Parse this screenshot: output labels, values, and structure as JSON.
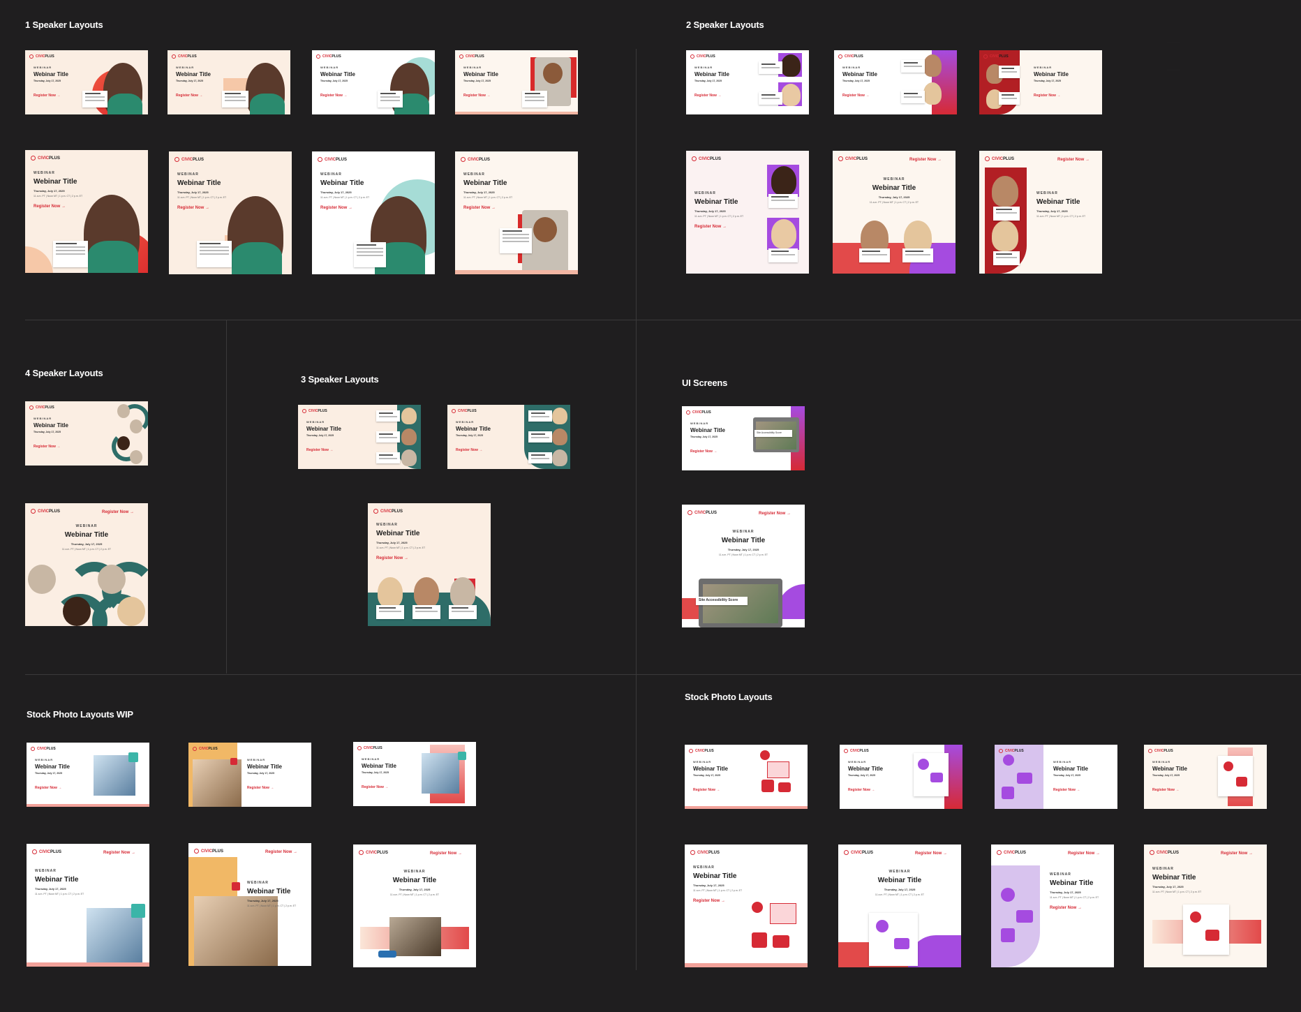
{
  "sections": {
    "one_speaker": "1 Speaker Layouts",
    "two_speaker": "2 Speaker Layouts",
    "four_speaker": "4 Speaker Layouts",
    "three_speaker": "3 Speaker Layouts",
    "ui_screens": "UI Screens",
    "stock_wip": "Stock Photo Layouts WIP",
    "stock": "Stock Photo Layouts"
  },
  "card": {
    "brand_prefix": "CIVIC",
    "brand_suffix": "PLUS",
    "eyebrow": "WEBINAR",
    "title": "Webinar Title",
    "date": "Thursday, July 17, 2025",
    "times": "11 a.m. PT  |  Noon MT  |  1 p.m. CT  |  2 p.m. ET",
    "register": "Register Now →",
    "speaker_label": "SPEAKER",
    "site_score": "Site Accessibility Score"
  },
  "colors": {
    "background": "#1f1e1f",
    "brand_red": "#d62a35",
    "teal": "#2e6d68",
    "purple": "#a54be0",
    "peach": "#fbeee3"
  }
}
